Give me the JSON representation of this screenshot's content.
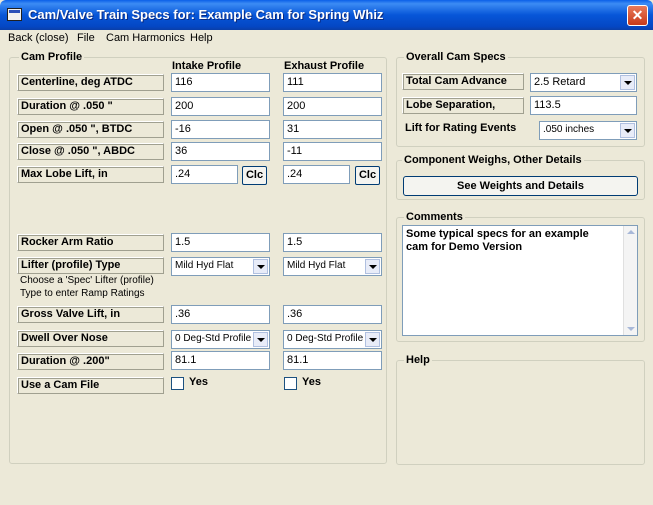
{
  "window": {
    "title": "Cam/Valve Train Specs for:  Example Cam for Spring Whiz"
  },
  "menu": [
    "Back (close)",
    "File",
    "Cam Harmonics",
    "Help"
  ],
  "cam_profile": {
    "title": "Cam Profile",
    "intake_header": "Intake Profile",
    "exhaust_header": "Exhaust Profile",
    "clc_label": "Clc",
    "rows": {
      "centerline": {
        "label": "Centerline, deg ATDC",
        "intake": "116",
        "exhaust": "111"
      },
      "duration": {
        "label": "Duration @ .050 \"",
        "intake": "200",
        "exhaust": "200"
      },
      "open": {
        "label": "Open @ .050 \", BTDC",
        "intake": "-16",
        "exhaust": "31"
      },
      "close": {
        "label": "Close @ .050 \", ABDC",
        "intake": "36",
        "exhaust": "-11"
      },
      "max_lobe": {
        "label": "Max Lobe Lift, in",
        "intake": ".24",
        "exhaust": ".24"
      },
      "rocker": {
        "label": "Rocker Arm Ratio",
        "intake": "1.5",
        "exhaust": "1.5"
      },
      "lifter": {
        "label": "Lifter (profile) Type",
        "intake": "Mild Hyd Flat",
        "exhaust": "Mild Hyd Flat"
      },
      "gross": {
        "label": "Gross Valve Lift, in",
        "intake": ".36",
        "exhaust": ".36"
      },
      "dwell": {
        "label": "Dwell Over Nose",
        "intake": "0 Deg-Std Profile",
        "exhaust": "0 Deg-Std Profile"
      },
      "duration200": {
        "label": "Duration @ .200\"",
        "intake": "81.1",
        "exhaust": "81.1"
      },
      "camfile": {
        "label": "Use a Cam File",
        "intake": "Yes",
        "exhaust": "Yes"
      }
    },
    "lifter_note_1": "Choose a 'Spec' Lifter (profile)",
    "lifter_note_2": "Type to enter Ramp Ratings"
  },
  "overall": {
    "title": "Overall Cam Specs",
    "advance_label": "Total Cam Advance",
    "advance_value": "2.5 Retard",
    "lobe_label": "Lobe Separation,",
    "lobe_value": "113.5",
    "lift_label": "Lift for Rating Events",
    "lift_value": ".050 inches"
  },
  "component": {
    "title": "Component Weighs, Other Details",
    "button": "See Weights and Details"
  },
  "comments": {
    "title": "Comments",
    "line1": "Some typical specs for an example",
    "line2": "cam for Demo Version"
  },
  "help": {
    "title": "Help"
  }
}
